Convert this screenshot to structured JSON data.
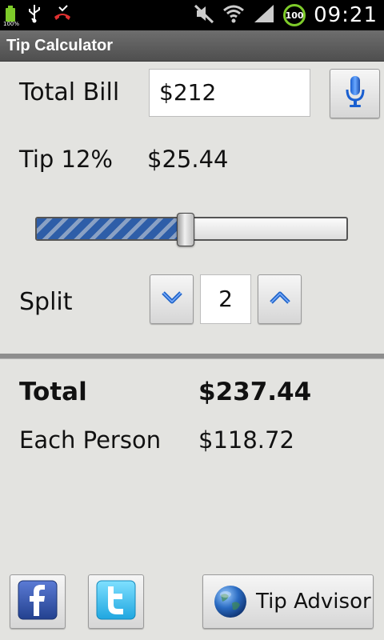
{
  "status_bar": {
    "time": "09:21",
    "battery_level": "100",
    "battery_small": "100%"
  },
  "app": {
    "title": "Tip Calculator"
  },
  "bill": {
    "label": "Total Bill",
    "value": "$212"
  },
  "tip": {
    "label": "Tip 12%",
    "amount": "$25.44",
    "slider_fraction": 0.48
  },
  "split": {
    "label": "Split",
    "value": "2"
  },
  "results": {
    "total_label": "Total",
    "total_value": "$237.44",
    "each_label": "Each Person",
    "each_value": "$118.72"
  },
  "footer": {
    "tip_advisor_label": "Tip Advisor"
  },
  "colors": {
    "accent": "#2e5ea8",
    "facebook": "#3b5998",
    "twitter": "#33ccff"
  }
}
